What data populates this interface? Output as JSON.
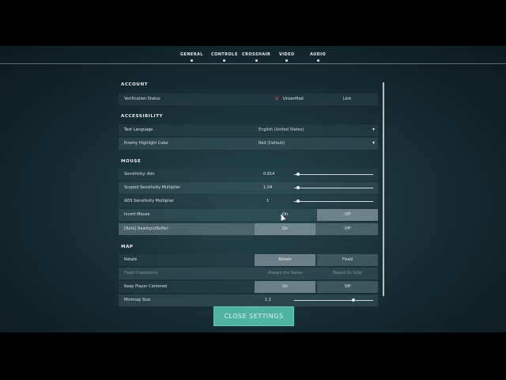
{
  "nav": {
    "tabs": [
      {
        "label": "GENERAL"
      },
      {
        "label": "CONTROLS"
      },
      {
        "label": "CROSSHAIR"
      },
      {
        "label": "VIDEO"
      },
      {
        "label": "AUDIO"
      }
    ]
  },
  "account": {
    "header": "ACCOUNT",
    "verification_label": "Verification Status",
    "verification_value": "Unverified",
    "link_label": "Link"
  },
  "accessibility": {
    "header": "ACCESSIBILITY",
    "text_language_label": "Text Language",
    "text_language_value": "English (United States)",
    "enemy_highlight_label": "Enemy Highlight Color",
    "enemy_highlight_value": "Red (Default)"
  },
  "mouse": {
    "header": "MOUSE",
    "sens_aim_label": "Sensitivity: Aim",
    "sens_aim_value": "0.914",
    "sens_aim_fraction": 0.05,
    "scoped_label": "Scoped Sensitivity Multiplier",
    "scoped_value": "1.04",
    "scoped_fraction": 0.05,
    "ads_label": "ADS Sensitivity Multiplier",
    "ads_value": "1",
    "ads_fraction": 0.05,
    "invert_label": "Invert Mouse",
    "invert_on": "On",
    "invert_off": "Off",
    "raw_label": "[Beta] RawInputBuffer",
    "raw_on": "On",
    "raw_off": "Off"
  },
  "map": {
    "header": "MAP",
    "rotate_label": "Rotate",
    "rotate_opt1": "Rotate",
    "rotate_opt2": "Fixed",
    "fixed_orient_label": "Fixed Orientation",
    "fixed_orient_opt1": "Always the Same",
    "fixed_orient_opt2": "Based On Side",
    "keep_centered_label": "Keep Player Centered",
    "keep_centered_on": "On",
    "keep_centered_off": "Off",
    "minimap_size_label": "Minimap Size",
    "minimap_size_value": "1.1",
    "minimap_fraction": 0.75
  },
  "footer": {
    "close_label": "CLOSE SETTINGS"
  }
}
